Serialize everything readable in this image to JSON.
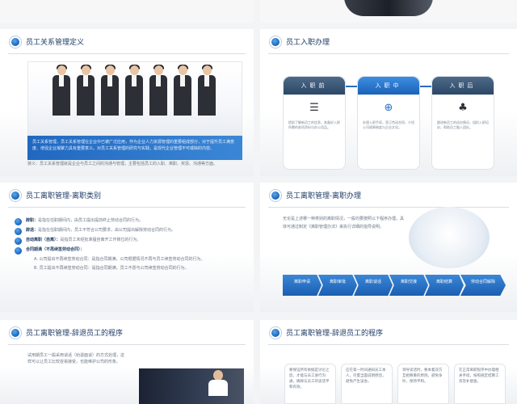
{
  "slides": {
    "s1": {
      "title": "员工关系管理定义",
      "band_text": "员工关系管理，员工关系管理在企业中已被广泛应用，作为企业人力资源管理的重要组成部分，对于提升员工满意度、增强企业凝聚力具有重要意义。对员工关系管理的研究与实践，是现代企业管理不可或缺的内容。",
      "bottom_text": "狭义：员工关系管理就是企业与员工之间的沟通与管理，主要包括员工的入职、离职、奖惩、沟通等方面。"
    },
    "s2": {
      "title": "员工入职办理",
      "steps": [
        {
          "label": "入职前",
          "icon": "checklist-icon",
          "text": "提前了解新员工的信息，准备好入职所需的各项资料与办公用品。"
        },
        {
          "label": "入职中",
          "icon": "globe-icon",
          "text": "办理入职手续，签订劳动合同，介绍公司规章制度与企业文化。"
        },
        {
          "label": "入职后",
          "icon": "people-icon",
          "text": "跟进新员工的适应情况，组织入职培训，帮助员工融入团队。"
        }
      ]
    },
    "s3": {
      "title": "员工离职管理-离职类别",
      "items": [
        {
          "label": "辞职：",
          "text": "是指在任职期间内，由员工提出提前终止劳动合同的行为。"
        },
        {
          "label": "辞退：",
          "text": "是指在任职期间内，员工不符合公司要求，由公司提出解除劳动合同的行为。"
        },
        {
          "label": "自动离职（自离）：",
          "text": "是指员工未经批准擅自离开工作岗位的行为。"
        },
        {
          "label": "合同期满（不再续签劳动合同）：",
          "text": ""
        }
      ],
      "subs": [
        "A. 公司提出不再续签劳动合同：是指合同期满，公司根据情况不再与员工续签劳动合同的行为。",
        "B. 员工提出不再续签劳动合同：是指合同期满，员工不愿与公司续签劳动合同的行为。"
      ]
    },
    "s4": {
      "title": "员工离职管理-离职办理",
      "para": "无论是上述哪一种类别的离职情况，一般均要按照以下程序办理，具体可通过制定《离职管理办法》来执行详细的指导说明。",
      "steps": [
        "离职申请",
        "离职审批",
        "离职谈话",
        "离职交接",
        "离职结算",
        "劳动合同解除"
      ]
    },
    "s5": {
      "title": "员工离职管理-辞退员工的程序",
      "para": "试用期员工一般采用谈话（劝退面谈）的方式处理，这样可以让员工比较容易接受，也能维护公司的形象。"
    },
    "s6": {
      "title": "员工离职管理-辞退员工的程序",
      "cols": [
        "要保证所有依据是讨论之后，才能与员工进行沟通，确保与员工的谈话平和有效。",
        "应在第一时间通知员工本人，尽量当面说明原因，避免产生误会。",
        "领导谈话时，要本着双方互相尊重的原则，避免争吵，保持平和。",
        "在正常离职程序中办理相关手续，按照规定结算工资及补偿金。"
      ]
    }
  }
}
